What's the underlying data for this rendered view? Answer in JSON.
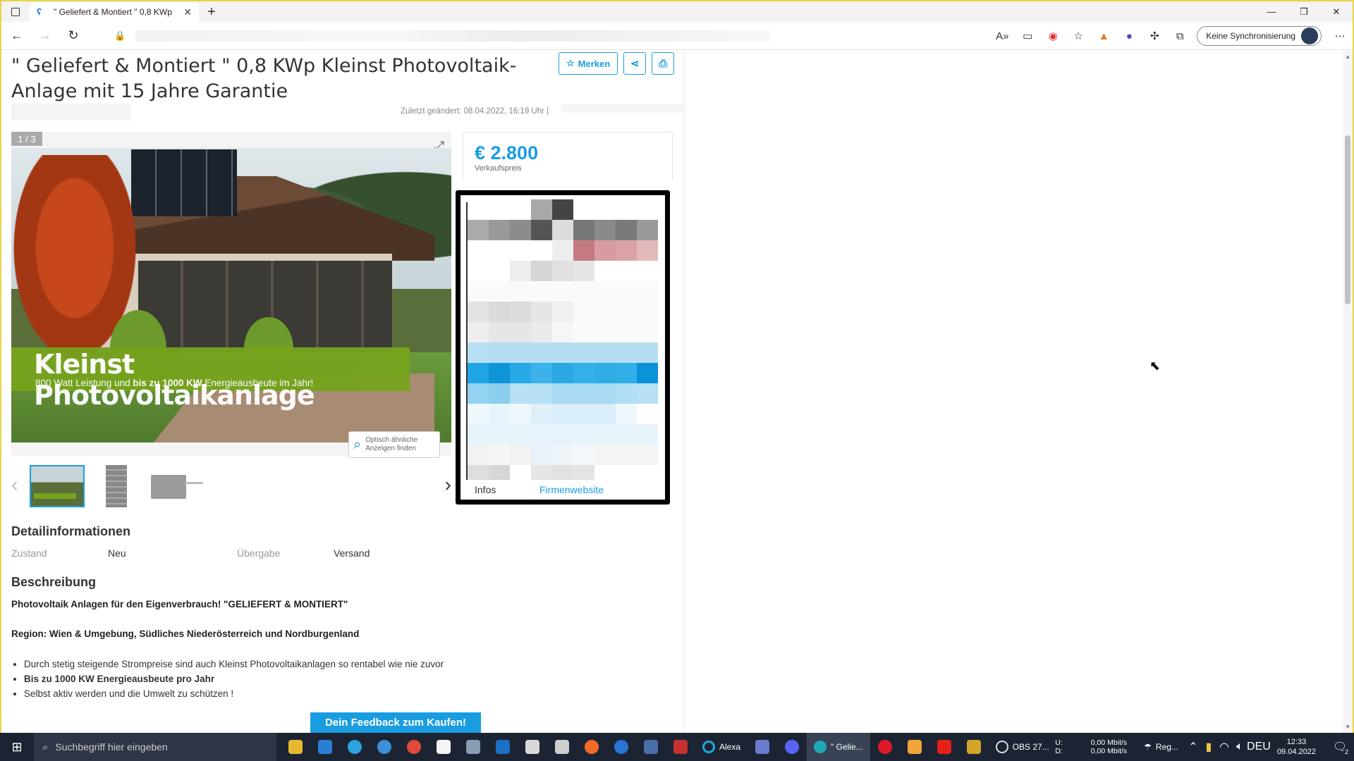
{
  "browser": {
    "tab_title": "\" Geliefert & Montiert \" 0,8 KWp",
    "tab_close": "✕",
    "new_tab": "+",
    "sync_label": "Keine Synchronisierung",
    "win_minimize": "—",
    "win_restore": "❐",
    "win_close": "✕"
  },
  "listing": {
    "title": "\" Geliefert & Montiert \" 0,8 KWp Kleinst Photovoltaik-Anlage mit 15 Jahre Garantie",
    "merken_label": "Merken",
    "last_changed": "Zuletzt geändert: 08.04.2022, 16:19 Uhr |",
    "image_counter": "1 / 3",
    "banner_title": "Kleinst Photovoltaikanlage",
    "banner_sub_prefix": "800 Watt Leistung und ",
    "banner_sub_bold": "bis zu 1000 KW",
    "banner_sub_suffix": " Energieausbeute im Jahr!",
    "similar_line1": "Optisch ähnliche",
    "similar_line2": "Anzeigen finden",
    "price": "€ 2.800",
    "price_label": "Verkaufspreis",
    "dealer_tab_infos": "Infos",
    "dealer_tab_website": "Firmenwebsite",
    "details_heading": "Detailinformationen",
    "zustand_key": "Zustand",
    "zustand_value": "Neu",
    "uebergabe_key": "Übergabe",
    "uebergabe_value": "Versand",
    "description_heading": "Beschreibung",
    "desc_line1": "Photovoltaik Anlagen für den Eigenverbrauch! \"GELIEFERT & MONTIERT\"",
    "desc_line2": "Region: Wien & Umgebung, Südliches Niederösterreich und Nordburgenland",
    "bullets": [
      "Durch stetig steigende Strompreise sind auch Kleinst Photovoltaikanlagen so rentabel wie nie zuvor",
      "Bis zu 1000 KW Energieausbeute pro Jahr",
      "Selbst aktiv werden und die Umwelt zu schützen !"
    ],
    "feedback_label": "Dein Feedback zum Kaufen!"
  },
  "taskbar": {
    "search_placeholder": "Suchbegriff hier eingeben",
    "alexa_label": "Alexa",
    "edge_label": "\" Gelie...",
    "obs_label": "OBS 27...",
    "reg_label": "Reg...",
    "upload_label": "U:",
    "download_label": "D:",
    "upload_rate": "0,00 Mbit/s",
    "download_rate": "0,00 Mbit/s",
    "language": "DEU",
    "time": "12:33",
    "date": "09.04.2022",
    "notifications": "2"
  },
  "colors": {
    "accent": "#1a9de0",
    "banner_green": "#76a31d",
    "window_border": "#e8d44a",
    "taskbar": "#1c2433"
  }
}
